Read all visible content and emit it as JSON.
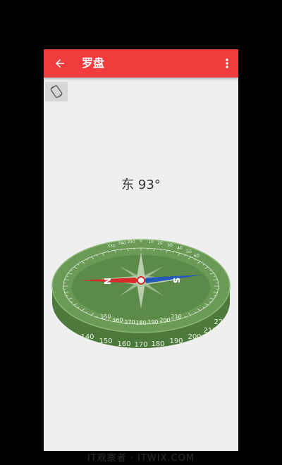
{
  "appbar": {
    "title": "罗盘",
    "back_icon": "arrow-left-icon",
    "menu_icon": "more-vertical-icon",
    "color": "#f03c3c"
  },
  "toolbar": {
    "rotate_icon": "screen-rotation-icon"
  },
  "heading": {
    "text": "东 93°"
  },
  "compass": {
    "top_numbers": [
      "330",
      "340",
      "350",
      "0",
      "10",
      "20",
      "30",
      "40",
      "50",
      "60"
    ],
    "front_numbers": [
      "150",
      "160",
      "170",
      "180",
      "190",
      "200",
      "210"
    ],
    "rim_numbers": [
      "140",
      "150",
      "160",
      "170",
      "180",
      "190",
      "200",
      "210",
      "220"
    ],
    "north_letter": "N",
    "south_letter": "S",
    "dial_color": "#5b8a4a",
    "needle_north_color": "#d82a2a",
    "needle_south_color": "#2458b8"
  },
  "watermark": "IT观察者 · ITWIX.COM"
}
